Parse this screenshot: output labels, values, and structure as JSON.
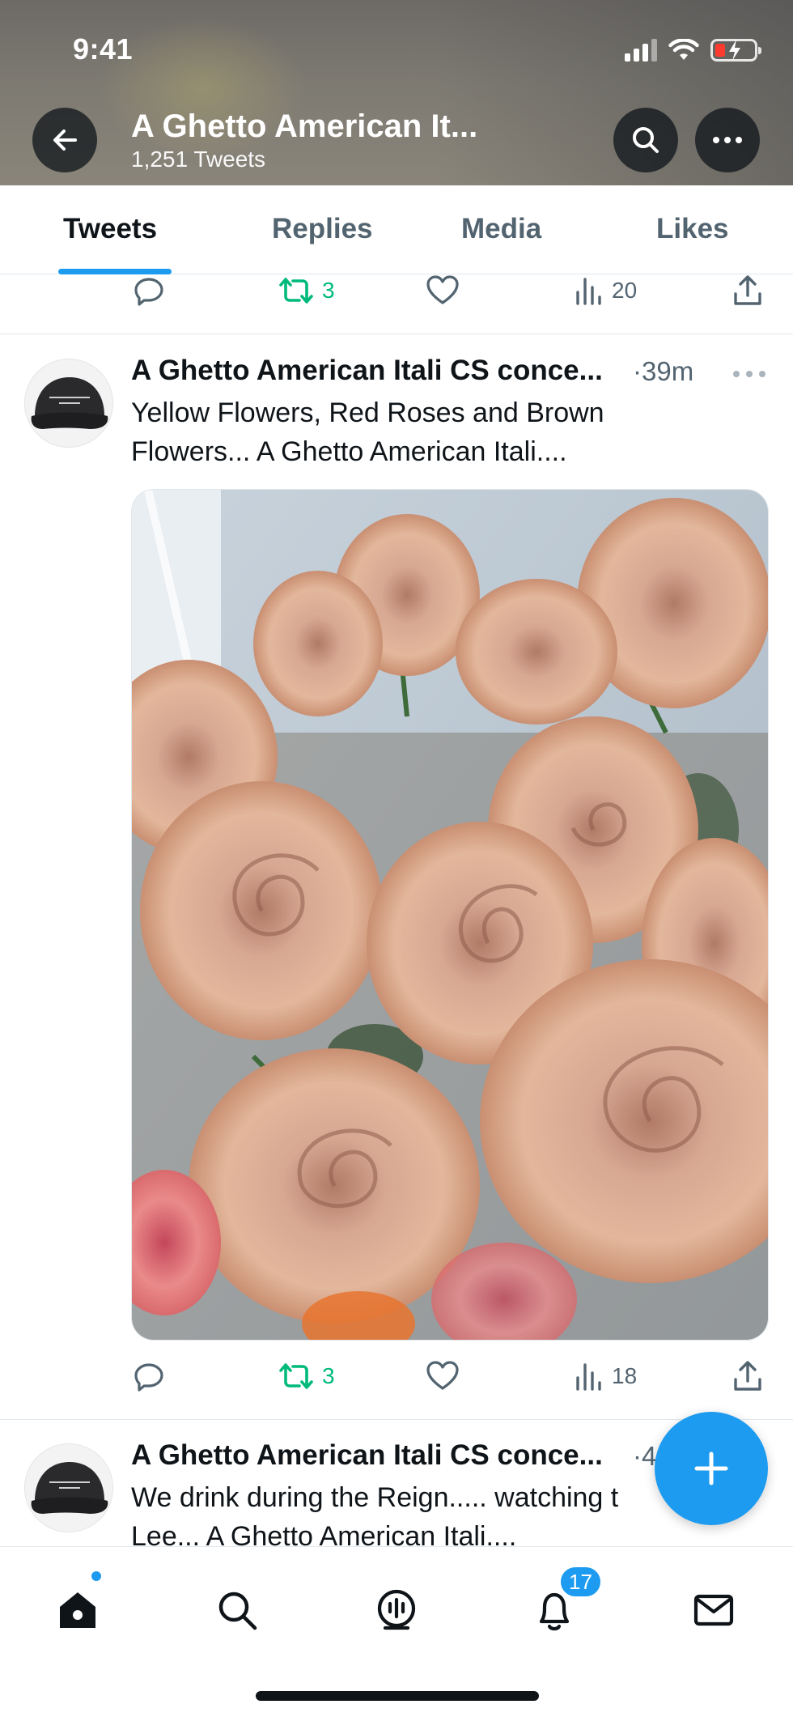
{
  "status_bar": {
    "time": "9:41"
  },
  "header": {
    "title": "A Ghetto American It...",
    "subtitle": "1,251 Tweets"
  },
  "tabs": [
    {
      "label": "Tweets",
      "active": true
    },
    {
      "label": "Replies",
      "active": false
    },
    {
      "label": "Media",
      "active": false
    },
    {
      "label": "Likes",
      "active": false
    }
  ],
  "prev_tweet_actions": {
    "retweets": "3",
    "views": "20"
  },
  "tweets": [
    {
      "name": "A Ghetto American Itali CS conce...",
      "time": "·39m",
      "text_line1": "Yellow Flowers, Red Roses and Brown",
      "text_line2": "Flowers... A Ghetto American Itali....",
      "retweets": "3",
      "views": "18",
      "media_description": "roses-photo"
    },
    {
      "name": "A Ghetto American Itali CS conce...",
      "time": "·4",
      "text_line1": "We drink during the Reign..... watching t",
      "text_line2": "Lee... A Ghetto American Itali...."
    }
  ],
  "bottom_nav": {
    "notifications_badge": "17",
    "items": [
      "home-icon",
      "search-icon",
      "spaces-icon",
      "notifications-icon",
      "messages-icon"
    ]
  },
  "colors": {
    "accent": "#1d9bf0",
    "retweet": "#00ba7c",
    "secondary_text": "#536471",
    "battery_low": "#ff3b30"
  }
}
